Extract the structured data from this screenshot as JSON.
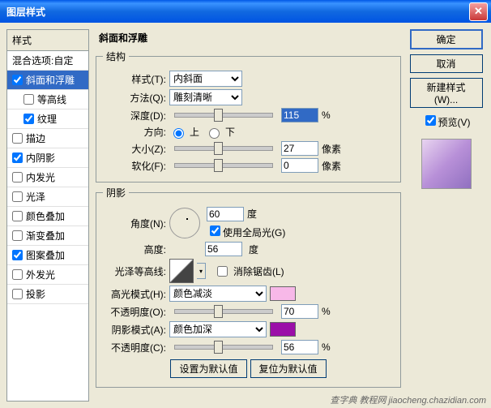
{
  "title": "图层样式",
  "left": {
    "header": "样式",
    "blend_label": "混合选项:自定",
    "items": [
      {
        "label": "斜面和浮雕",
        "checked": true,
        "selected": true,
        "indent": 0
      },
      {
        "label": "等高线",
        "checked": false,
        "selected": false,
        "indent": 1
      },
      {
        "label": "纹理",
        "checked": true,
        "selected": false,
        "indent": 1
      },
      {
        "label": "描边",
        "checked": false,
        "selected": false,
        "indent": 0
      },
      {
        "label": "内阴影",
        "checked": true,
        "selected": false,
        "indent": 0
      },
      {
        "label": "内发光",
        "checked": false,
        "selected": false,
        "indent": 0
      },
      {
        "label": "光泽",
        "checked": false,
        "selected": false,
        "indent": 0
      },
      {
        "label": "颜色叠加",
        "checked": false,
        "selected": false,
        "indent": 0
      },
      {
        "label": "渐变叠加",
        "checked": false,
        "selected": false,
        "indent": 0
      },
      {
        "label": "图案叠加",
        "checked": true,
        "selected": false,
        "indent": 0
      },
      {
        "label": "外发光",
        "checked": false,
        "selected": false,
        "indent": 0
      },
      {
        "label": "投影",
        "checked": false,
        "selected": false,
        "indent": 0
      }
    ]
  },
  "section_title": "斜面和浮雕",
  "structure": {
    "legend": "结构",
    "style_label": "样式(T):",
    "style_value": "内斜面",
    "method_label": "方法(Q):",
    "method_value": "雕刻清晰",
    "depth_label": "深度(D):",
    "depth_value": "115",
    "pct": "%",
    "direction_label": "方向:",
    "up": "上",
    "down": "下",
    "size_label": "大小(Z):",
    "size_value": "27",
    "px": "像素",
    "soften_label": "软化(F):",
    "soften_value": "0"
  },
  "shading": {
    "legend": "阴影",
    "angle_label": "角度(N):",
    "angle_value": "60",
    "deg": "度",
    "global_label": "使用全局光(G)",
    "altitude_label": "高度:",
    "altitude_value": "56",
    "gloss_label": "光泽等高线:",
    "antialias_label": "消除锯齿(L)",
    "hmode_label": "高光模式(H):",
    "hmode_value": "颜色减淡",
    "hcolor": "#F7B8E8",
    "hopacity_label": "不透明度(O):",
    "hopacity_value": "70",
    "smode_label": "阴影模式(A):",
    "smode_value": "颜色加深",
    "scolor": "#9B0FA8",
    "sopacity_label": "不透明度(C):",
    "sopacity_value": "56"
  },
  "buttons": {
    "default": "设置为默认值",
    "reset": "复位为默认值"
  },
  "right": {
    "ok": "确定",
    "cancel": "取消",
    "new_style": "新建样式(W)...",
    "preview": "预览(V)"
  },
  "watermark": "查字典 教程网 jiaocheng.chazidian.com"
}
